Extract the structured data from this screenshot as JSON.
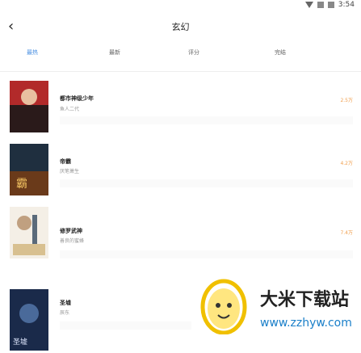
{
  "status_bar": {
    "time": "3:54"
  },
  "header": {
    "title": "玄幻"
  },
  "tabs": [
    {
      "label": "最热"
    },
    {
      "label": "最新"
    },
    {
      "label": "评分"
    },
    {
      "label": "完结"
    }
  ],
  "books": [
    {
      "title": "都市神级少年",
      "author": "鱼人二代",
      "count": "2.5万"
    },
    {
      "title": "帝霸",
      "author": "厌笔萧生",
      "count": "4.2万"
    },
    {
      "title": "修罗武神",
      "author": "善良的蜜蜂",
      "count": "7.4万"
    },
    {
      "title": "圣墟",
      "author": "辰东",
      "count": ""
    }
  ],
  "watermark": {
    "brand": "大米下载站",
    "url": "www.zzhyw.com"
  }
}
